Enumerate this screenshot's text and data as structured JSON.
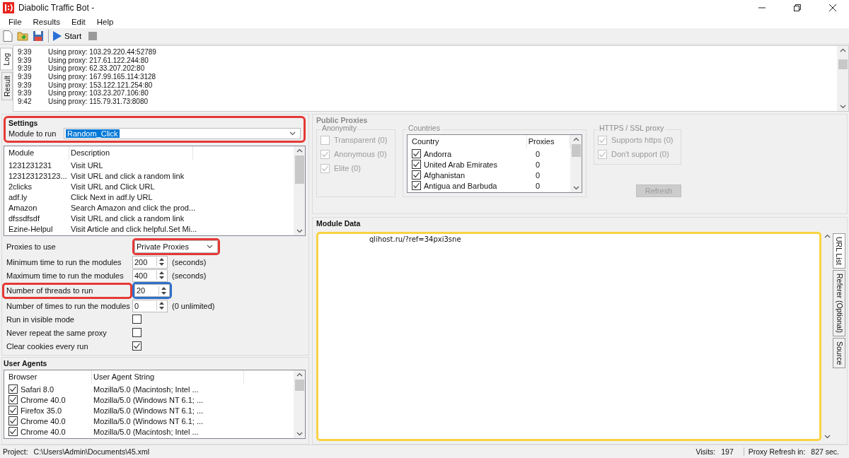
{
  "window": {
    "title": "Diabolic Traffic Bot -"
  },
  "menu": [
    "File",
    "Results",
    "Edit",
    "Help"
  ],
  "toolbar": [
    {
      "kind": "new"
    },
    {
      "kind": "open"
    },
    {
      "kind": "save"
    },
    {
      "kind": "separator"
    },
    {
      "kind": "start",
      "label": "Start"
    },
    {
      "kind": "stop"
    }
  ],
  "side_tabs": [
    {
      "label": "Log",
      "selected": true
    },
    {
      "label": "Result",
      "selected": false
    }
  ],
  "log": [
    {
      "time": "9:39",
      "message": "Using proxy: 103.29.220.44:52789"
    },
    {
      "time": "9:39",
      "message": "Using proxy: 217.61.122.244:80"
    },
    {
      "time": "9:39",
      "message": "Using proxy: 62.33.207.202:80"
    },
    {
      "time": "9:39",
      "message": "Using proxy: 167.99.165.114:3128"
    },
    {
      "time": "9:39",
      "message": "Using proxy: 153.122.121.254:80"
    },
    {
      "time": "9:39",
      "message": "Using proxy: 103.23.207.106:80"
    },
    {
      "time": "9:42",
      "message": "Using proxy: 115.79.31.73:8080"
    }
  ],
  "settings": {
    "title": "Settings",
    "frame": {
      "color": "#e53935"
    },
    "module_label": "Module to run",
    "module_value": "Random_Click",
    "modules": {
      "columns": [
        "Module",
        "Description"
      ],
      "rows": [
        [
          "1231231231",
          "Visit URL"
        ],
        [
          "123123123123...",
          "Visit URL and click a random link"
        ],
        [
          "2clicks",
          "Visit URL and Click URL"
        ],
        [
          "adf.ly",
          "Click Next in adf.ly URL"
        ],
        [
          "Amazon",
          "Search Amazon and click the prod..."
        ],
        [
          "dfssdfsdf",
          "Visit URL and click a random link"
        ],
        [
          "Ezine-Helpul",
          "Visit Article and click helpful.Set Mi..."
        ]
      ]
    },
    "fields": [
      {
        "kind": "combo",
        "label": "Proxies to use",
        "value": "Private Proxies",
        "field_frame": {
          "color": "#e53935"
        }
      },
      {
        "kind": "spin",
        "label": "Minimum time to run the modules",
        "value": "200",
        "unit": "(seconds)"
      },
      {
        "kind": "spin",
        "label": "Maximum time to run the modules",
        "value": "400",
        "unit": "(seconds)"
      },
      {
        "kind": "spin",
        "label": "Number of threads to run",
        "value": "20",
        "label_frame": {
          "color": "#e53935"
        },
        "field_frame": {
          "color": "#2f6fc9"
        }
      },
      {
        "kind": "spin",
        "label": "Number of times to run the modules",
        "value": "0",
        "unit": "(0 unlimited)"
      },
      {
        "kind": "check",
        "label": "Run in visible mode",
        "checked": false
      },
      {
        "kind": "check",
        "label": "Never repeat the same proxy",
        "checked": false
      },
      {
        "kind": "check",
        "label": "Clear cookies every run",
        "checked": true
      }
    ]
  },
  "user_agents": {
    "title": "User Agents",
    "columns": [
      "Browser",
      "User Agent String"
    ],
    "rows": [
      {
        "browser": "Safari 8.0",
        "agent": "Mozilla/5.0 (Macintosh; Intel ...",
        "checked": true
      },
      {
        "browser": "Chrome 40.0",
        "agent": "Mozilla/5.0 (Windows NT 6.1; ...",
        "checked": true
      },
      {
        "browser": "Firefox 35.0",
        "agent": "Mozilla/5.0 (Windows NT 6.1; ...",
        "checked": true
      },
      {
        "browser": "Chrome 40.0",
        "agent": "Mozilla/5.0 (Windows NT 6.1; ...",
        "checked": true
      },
      {
        "browser": "Chrome 40.0",
        "agent": "Mozilla/5.0 (Macintosh; Intel ...",
        "checked": true
      }
    ]
  },
  "public_proxies": {
    "title": "Public Proxies",
    "anonymity": {
      "title": "Anonymity",
      "options": [
        {
          "label": "Transparent (0)",
          "checked": false,
          "disabled": true
        },
        {
          "label": "Anonymous (0)",
          "checked": true,
          "disabled": true
        },
        {
          "label": "Elite (0)",
          "checked": true,
          "disabled": true
        }
      ]
    },
    "countries": {
      "title": "Countries",
      "columns": [
        "Country",
        "Proxies"
      ],
      "rows": [
        {
          "name": "Andorra",
          "proxies": "0",
          "checked": true
        },
        {
          "name": "United Arab Emirates",
          "proxies": "0",
          "checked": true
        },
        {
          "name": "Afghanistan",
          "proxies": "0",
          "checked": true
        },
        {
          "name": "Antigua and Barbuda",
          "proxies": "0",
          "checked": true
        }
      ]
    },
    "https": {
      "title": "HTTPS / SSL proxy",
      "options": [
        {
          "label": "Supports https (0)",
          "checked": true,
          "disabled": true
        },
        {
          "label": "Don't support (0)",
          "checked": true,
          "disabled": true
        }
      ]
    },
    "refresh_button": {
      "label": "Refresh",
      "disabled": true
    }
  },
  "module_data": {
    "title": "Module Data",
    "text": "qlihost.ru/?ref=34pxi3sne",
    "frame": {
      "color": "#f9d342"
    },
    "tabs": [
      {
        "label": "URL List",
        "selected": true
      },
      {
        "label": "Referer (Optional)",
        "selected": false
      },
      {
        "label": "Source",
        "selected": false
      }
    ]
  },
  "status_bar": {
    "project_label": "Project:",
    "project_path": "C:\\Users\\Admin\\Documents\\45.xml",
    "visits_label": "Visits:",
    "visits": "197",
    "refresh_label": "Proxy Refresh in:",
    "refresh": "827 sec."
  }
}
